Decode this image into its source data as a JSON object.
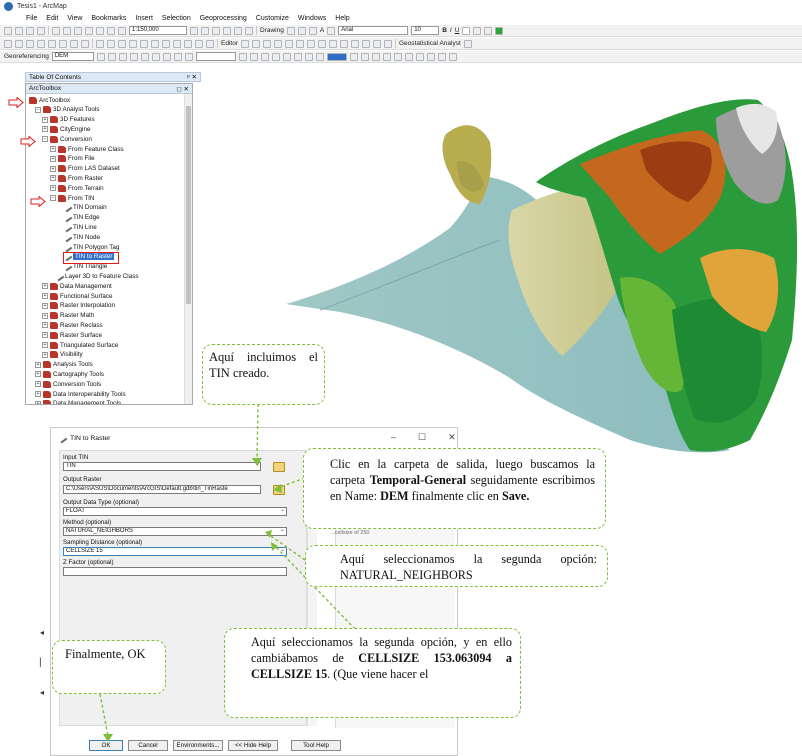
{
  "window": {
    "title": "Tesis1 - ArcMap"
  },
  "menu": [
    "File",
    "Edit",
    "View",
    "Bookmarks",
    "Insert",
    "Selection",
    "Geoprocessing",
    "Customize",
    "Windows",
    "Help"
  ],
  "toolbar1": {
    "scale": "1:150,000",
    "drawing_label": "Drawing",
    "font_name": "Arial",
    "font_size": "10",
    "bold": "B",
    "italic": "I",
    "underline": "U",
    "text_tool": "A"
  },
  "toolbar2": {
    "editor_label": "Editor",
    "geostat_label": "Geostatistical Analyst"
  },
  "toolbar3": {
    "georef_label": "Georeferencing",
    "layer_value": "DEM"
  },
  "toc": {
    "title": "Table Of Contents",
    "controls": "ᵖ ✕"
  },
  "arctoolbox": {
    "title": "ArcToolbox",
    "controls": "◻ ✕",
    "items": [
      {
        "label": "ArcToolbox",
        "kind": "root"
      },
      {
        "label": "3D Analyst Tools",
        "kind": "toolbox",
        "exp": "−"
      },
      {
        "label": "3D Features",
        "kind": "toolset",
        "exp": "+"
      },
      {
        "label": "CityEngine",
        "kind": "toolset",
        "exp": "+"
      },
      {
        "label": "Conversion",
        "kind": "toolset",
        "exp": "−"
      },
      {
        "label": "From Feature Class",
        "kind": "toolset",
        "exp": "+"
      },
      {
        "label": "From File",
        "kind": "toolset",
        "exp": "+"
      },
      {
        "label": "From LAS Dataset",
        "kind": "toolset",
        "exp": "+"
      },
      {
        "label": "From Raster",
        "kind": "toolset",
        "exp": "+"
      },
      {
        "label": "From Terrain",
        "kind": "toolset",
        "exp": "+"
      },
      {
        "label": "From TIN",
        "kind": "toolset",
        "exp": "−"
      },
      {
        "label": "TIN Domain",
        "kind": "tool"
      },
      {
        "label": "TIN Edge",
        "kind": "tool"
      },
      {
        "label": "TIN Line",
        "kind": "tool"
      },
      {
        "label": "TIN Node",
        "kind": "tool"
      },
      {
        "label": "TIN Polygon Tag",
        "kind": "tool"
      },
      {
        "label": "TIN to Raster",
        "kind": "tool",
        "selected": true
      },
      {
        "label": "TIN Triangle",
        "kind": "tool"
      },
      {
        "label": "Layer 3D to Feature Class",
        "kind": "tool"
      },
      {
        "label": "Data Management",
        "kind": "toolset",
        "exp": "+"
      },
      {
        "label": "Functional Surface",
        "kind": "toolset",
        "exp": "+"
      },
      {
        "label": "Raster Interpolation",
        "kind": "toolset",
        "exp": "+"
      },
      {
        "label": "Raster Math",
        "kind": "toolset",
        "exp": "+"
      },
      {
        "label": "Raster Reclass",
        "kind": "toolset",
        "exp": "+"
      },
      {
        "label": "Raster Surface",
        "kind": "toolset",
        "exp": "+"
      },
      {
        "label": "Triangulated Surface",
        "kind": "toolset",
        "exp": "+"
      },
      {
        "label": "Visibility",
        "kind": "toolset",
        "exp": "+"
      },
      {
        "label": "Analysis Tools",
        "kind": "toolbox",
        "exp": "+"
      },
      {
        "label": "Cartography Tools",
        "kind": "toolbox",
        "exp": "+"
      },
      {
        "label": "Conversion Tools",
        "kind": "toolbox",
        "exp": "+"
      },
      {
        "label": "Data Interoperability Tools",
        "kind": "toolbox",
        "exp": "+"
      },
      {
        "label": "Data Management Tools",
        "kind": "toolbox",
        "exp": "+"
      }
    ]
  },
  "dialog": {
    "title": "TIN to Raster",
    "win_buttons": [
      "–",
      "☐",
      "✕"
    ],
    "input_tin_label": "Input TIN",
    "input_tin_value": "TIN",
    "output_raster_label": "Output Raster",
    "output_raster_value": "C:\\Users\\ASUS\\Documents\\ArcGIS\\Default.gdb\\tin_TinRaste",
    "data_type_label": "Output Data Type (optional)",
    "data_type_value": "FLOAT",
    "method_label": "Method (optional)",
    "method_value": "NATURAL_NEIGHBORS",
    "sampling_label": "Sampling Distance (optional)",
    "sampling_value": "CELLSIZE 15",
    "zfactor_label": "Z Factor (optional)",
    "zfactor_value": "",
    "help_snippet": "...cellsize of 250",
    "buttons": {
      "ok": "OK",
      "cancel": "Cancel",
      "environments": "Environments...",
      "hide_help": "<< Hide Help",
      "tool_help": "Tool Help"
    }
  },
  "callouts": {
    "c1": "Aquí incluimos el TIN creado.",
    "c2_a": "Clic en la carpeta de salida, luego buscamos la carpeta ",
    "c2_b": "Temporal-General",
    "c2_c": " seguidamente escribimos en Name: ",
    "c2_d": "DEM",
    "c2_e": " finalmente clic en ",
    "c2_f": "Save.",
    "c3": "Aquí seleccionamos la segunda opción: NATURAL_NEIGHBORS",
    "c4_a": "Aquí seleccionamos la segunda opción, y en ello cambiábamos de ",
    "c4_b": "CELLSIZE 153.063094 a CELLSIZE 15",
    "c4_c": ". (Que viene hacer el",
    "c5": "Finalmente, OK"
  },
  "colors": {
    "callout_border": "#7fbf3a",
    "arrow_red": "#e01b1b",
    "selection_blue": "#3370cc"
  }
}
